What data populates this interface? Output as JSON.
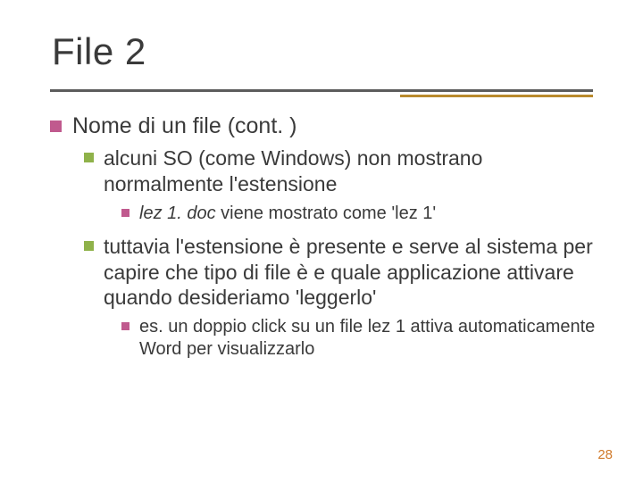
{
  "title": "File 2",
  "heading": "Nome di un file (cont. )",
  "sub1": "alcuni SO (come Windows) non mostrano normalmente l'estensione",
  "sub1_ex_em": "lez 1. doc",
  "sub1_ex_rest": " viene mostrato come 'lez 1'",
  "sub2": "tuttavia l'estensione è presente e serve al sistema per capire che tipo di file è e quale applicazione attivare quando desideriamo 'leggerlo'",
  "sub2_ex": "es. un doppio click su un file lez 1 attiva automaticamente Word per visualizzarlo",
  "page": "28"
}
